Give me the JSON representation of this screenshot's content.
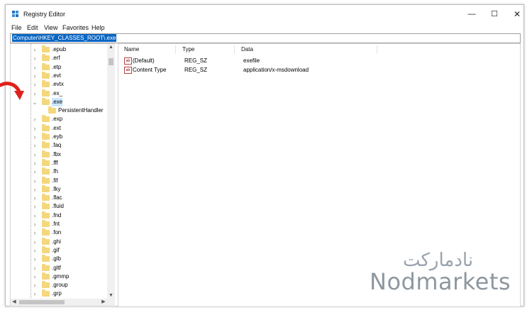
{
  "window": {
    "title": "Registry Editor",
    "controls": {
      "minimize": "—",
      "maximize": "☐",
      "close": "✕"
    }
  },
  "menu": [
    "File",
    "Edit",
    "View",
    "Favorites",
    "Help"
  ],
  "address": "Computer\\HKEY_CLASSES_ROOT\\.exe",
  "tree": {
    "items": [
      {
        "label": ".epub",
        "expander": "›"
      },
      {
        "label": ".erf",
        "expander": "›"
      },
      {
        "label": ".etp",
        "expander": "›"
      },
      {
        "label": ".evt",
        "expander": "›"
      },
      {
        "label": ".evtx",
        "expander": "›"
      },
      {
        "label": ".ex_",
        "expander": "›"
      },
      {
        "label": ".exe",
        "expander": "⌄"
      },
      {
        "label": "PersistentHandler",
        "expander": ""
      },
      {
        "label": ".exp",
        "expander": "›"
      },
      {
        "label": ".ext",
        "expander": "›"
      },
      {
        "label": ".eyb",
        "expander": "›"
      },
      {
        "label": ".faq",
        "expander": "›"
      },
      {
        "label": ".fbx",
        "expander": "›"
      },
      {
        "label": ".fff",
        "expander": "›"
      },
      {
        "label": ".fh",
        "expander": "›"
      },
      {
        "label": ".fif",
        "expander": "›"
      },
      {
        "label": ".fky",
        "expander": "›"
      },
      {
        "label": ".flac",
        "expander": "›"
      },
      {
        "label": ".fluid",
        "expander": "›"
      },
      {
        "label": ".fnd",
        "expander": "›"
      },
      {
        "label": ".fnt",
        "expander": "›"
      },
      {
        "label": ".fon",
        "expander": "›"
      },
      {
        "label": ".ghi",
        "expander": "›"
      },
      {
        "label": ".gif",
        "expander": "›"
      },
      {
        "label": ".glb",
        "expander": "›"
      },
      {
        "label": ".gltf",
        "expander": "›"
      },
      {
        "label": ".gmmp",
        "expander": "›"
      },
      {
        "label": ".group",
        "expander": "›"
      },
      {
        "label": ".grp",
        "expander": "›"
      }
    ]
  },
  "list": {
    "headers": {
      "name": "Name",
      "type": "Type",
      "data": "Data"
    },
    "rows": [
      {
        "name": "(Default)",
        "type": "REG_SZ",
        "data": "exefile",
        "icon": "ab"
      },
      {
        "name": "Content Type",
        "type": "REG_SZ",
        "data": "application/x-msdownload",
        "icon": "ab"
      }
    ]
  },
  "watermark": {
    "arabic": "نادمارکت",
    "latin": "Nodmarkets"
  },
  "colors": {
    "selection": "#0a66c4",
    "tree_selected": "#cce8ff",
    "folder": "#f5d77b",
    "arrow": "#e0201b"
  }
}
